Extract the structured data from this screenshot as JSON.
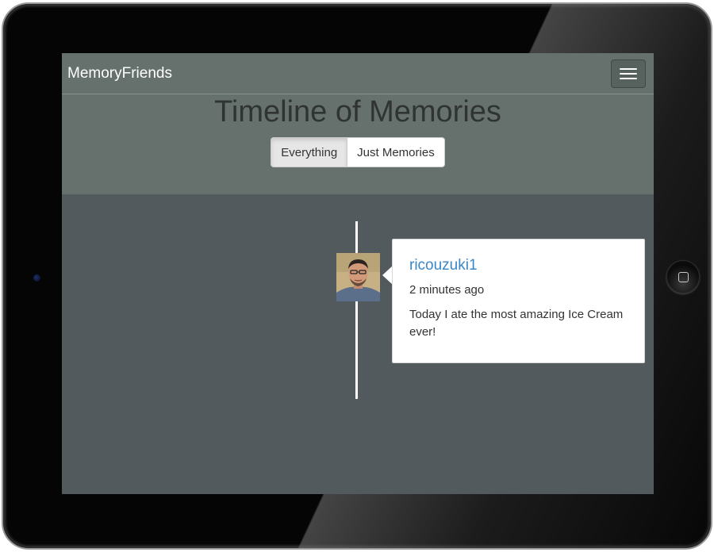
{
  "navbar": {
    "brand": "MemoryFriends",
    "menu_icon": "hamburger-menu-icon"
  },
  "header": {
    "title": "Timeline of Memories",
    "filters": [
      "Everything",
      "Just Memories"
    ],
    "active_filter": "Everything"
  },
  "timeline": {
    "posts": [
      {
        "username": "ricouzuki1",
        "time": "2 minutes ago",
        "text": "Today I ate the most amazing Ice Cream ever!"
      }
    ]
  },
  "colors": {
    "navbar_bg": "#66716d",
    "content_bg": "#525a5e",
    "username": "#3a87c7"
  }
}
